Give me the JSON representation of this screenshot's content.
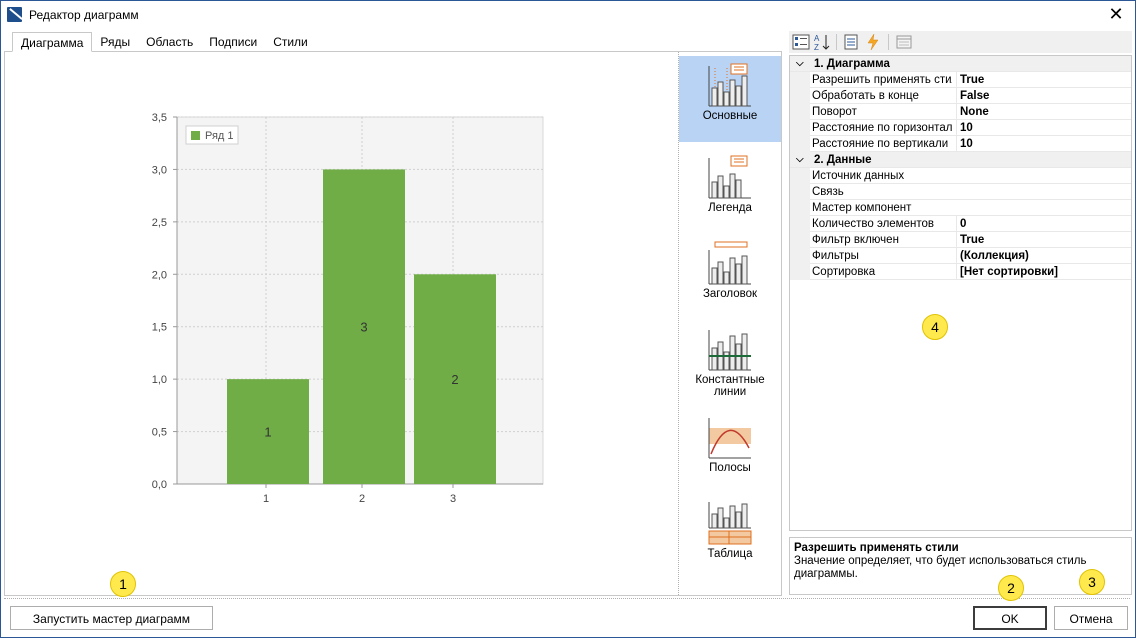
{
  "window": {
    "title": "Редактор диаграмм"
  },
  "tabs": [
    {
      "label": "Диаграмма",
      "active": true
    },
    {
      "label": "Ряды"
    },
    {
      "label": "Область"
    },
    {
      "label": "Подписи"
    },
    {
      "label": "Стили"
    }
  ],
  "chart_data": {
    "type": "bar",
    "categories": [
      "1",
      "2",
      "3"
    ],
    "series": [
      {
        "name": "Ряд 1",
        "values": [
          1,
          3,
          2
        ],
        "color": "#70ad47"
      }
    ],
    "data_labels": [
      "1",
      "3",
      "2"
    ],
    "ylim": [
      0,
      3.5
    ],
    "yticks": [
      "0,0",
      "0,5",
      "1,0",
      "1,5",
      "2,0",
      "2,5",
      "3,0",
      "3,5"
    ],
    "grid": true,
    "legend": "top-left",
    "title": "",
    "xlabel": "",
    "ylabel": ""
  },
  "chart_types": [
    {
      "label": "Основные",
      "icon": "basic-chart-icon",
      "active": true
    },
    {
      "label": "Легенда",
      "icon": "legend-chart-icon"
    },
    {
      "label": "Заголовок",
      "icon": "title-chart-icon"
    },
    {
      "label": "Константные линии",
      "icon": "constant-lines-chart-icon"
    },
    {
      "label": "Полосы",
      "icon": "strips-chart-icon"
    },
    {
      "label": "Таблица",
      "icon": "table-chart-icon"
    }
  ],
  "property_grid": {
    "toolbar": [
      "categorized-icon",
      "alphabetical-icon",
      "properties-icon",
      "events-icon",
      "property-pages-icon"
    ],
    "categories": [
      {
        "name": "1. Диаграмма",
        "props": [
          {
            "name": "Разрешить применять стили",
            "value": "True"
          },
          {
            "name": "Обработать в конце",
            "value": "False"
          },
          {
            "name": "Поворот",
            "value": "None"
          },
          {
            "name": "Расстояние по горизонтали",
            "value": "10"
          },
          {
            "name": "Расстояние по вертикали",
            "value": "10"
          }
        ]
      },
      {
        "name": "2. Данные",
        "props": [
          {
            "name": "Источник данных",
            "value": ""
          },
          {
            "name": "Связь",
            "value": ""
          },
          {
            "name": "Мастер компонент",
            "value": ""
          },
          {
            "name": "Количество элементов",
            "value": "0"
          },
          {
            "name": "Фильтр включен",
            "value": "True"
          },
          {
            "name": "Фильтры",
            "value": "(Коллекция)"
          },
          {
            "name": "Сортировка",
            "value": "[Нет сортировки]"
          }
        ]
      }
    ],
    "description": {
      "title": "Разрешить применять стили",
      "text": "Значение определяет, что будет использоваться стиль диаграммы."
    }
  },
  "buttons": {
    "wizard": "Запустить мастер диаграмм",
    "ok": "OK",
    "cancel": "Отмена"
  },
  "annotations": [
    "1",
    "2",
    "3",
    "4"
  ],
  "colors": {
    "accent": "#b9d3f5",
    "bar": "#70ad47",
    "badge": "#ffe94d"
  }
}
